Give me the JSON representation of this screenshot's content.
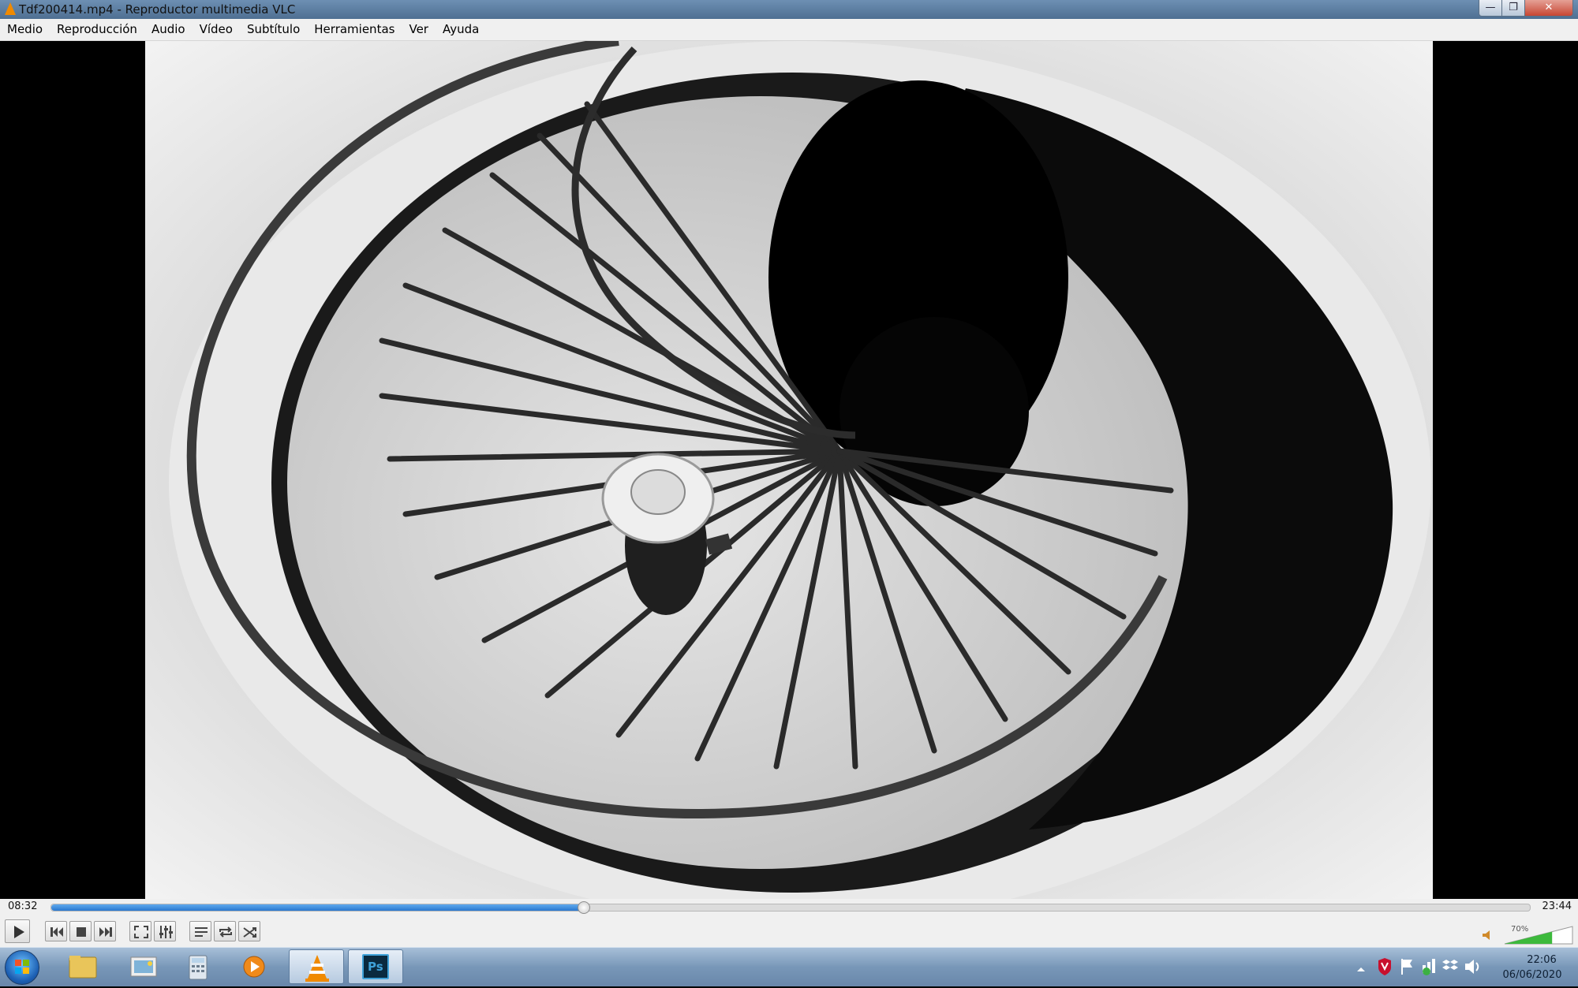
{
  "window": {
    "title": "Tdf200414.mp4 - Reproductor multimedia VLC",
    "icon": "vlc-cone-icon",
    "controls": {
      "minimize": "—",
      "maximize": "❐",
      "close": "✕"
    }
  },
  "menu": {
    "items": [
      "Medio",
      "Reproducción",
      "Audio",
      "Vídeo",
      "Subtítulo",
      "Herramientas",
      "Ver",
      "Ayuda"
    ]
  },
  "video": {
    "content": "black-and-white spiral staircase photo"
  },
  "seek": {
    "elapsed": "08:32",
    "total": "23:44",
    "progress": 0.36
  },
  "controls": {
    "buttons": [
      "play-icon",
      "previous-icon",
      "stop-icon",
      "next-icon",
      "fullscreen-icon",
      "extended-settings-icon",
      "playlist-icon",
      "loop-icon",
      "shuffle-icon"
    ]
  },
  "volume": {
    "percent_label": "70%",
    "level": 0.7
  },
  "taskbar": {
    "apps": [
      "file-explorer-icon",
      "photo-viewer-icon",
      "calculator-icon",
      "media-player-icon",
      "vlc-icon",
      "photoshop-icon"
    ],
    "photoshop_label": "Ps",
    "clock_time": "22:06",
    "clock_date": "06/06/2020",
    "tray_icons": [
      "show-hidden-icons-icon",
      "mcafee-icon",
      "action-center-flag-icon",
      "network-icon",
      "dropbox-icon",
      "speaker-icon"
    ]
  },
  "colors": {
    "seek_fill": "#2a78cf",
    "vlc_orange": "#f08a00",
    "photoshop_bg": "#0a2a3f"
  }
}
